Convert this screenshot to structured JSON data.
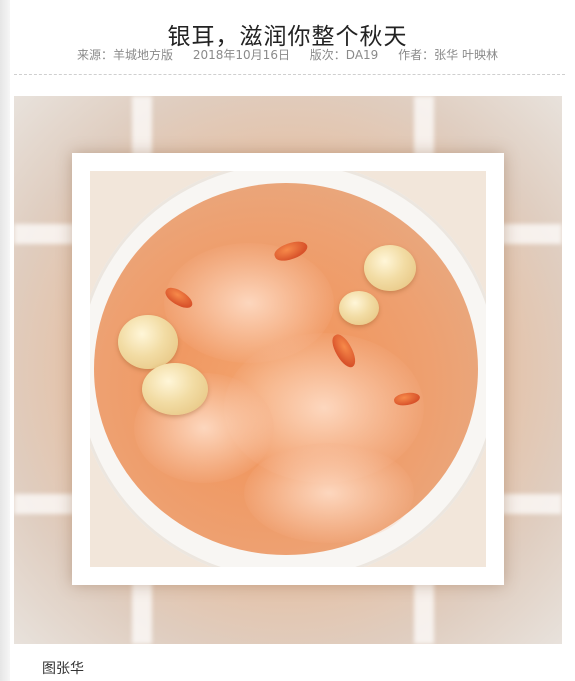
{
  "article": {
    "title": "银耳，滋润你整个秋天",
    "meta": {
      "source": "来源：羊城地方版",
      "date": "2018年10月16日",
      "edition": "版次：DA19",
      "author": "作者：张华 叶映林"
    },
    "photo_caption": "图张华"
  }
}
